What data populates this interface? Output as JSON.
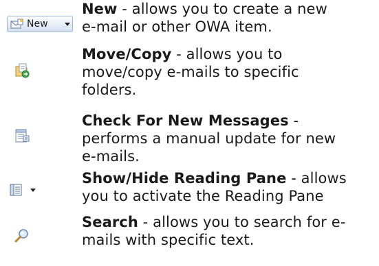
{
  "items": [
    {
      "icon": "new-item-icon",
      "button_label": "New",
      "term": "New",
      "lines": [
        " - allows you to create a new",
        "e-mail or other OWA item."
      ]
    },
    {
      "icon": "move-copy-icon",
      "term": "Move/Copy",
      "lines": [
        " - allows you to",
        "move/copy e-mails to specific",
        "folders."
      ]
    },
    {
      "icon": "check-messages-icon",
      "term": "Check For New Messages",
      "lines": [
        " -",
        "performs a manual update for new",
        "e-mails."
      ]
    },
    {
      "icon": "reading-pane-icon",
      "term": "Show/Hide Reading Pane",
      "lines": [
        " - allows",
        "you to activate the Reading Pane"
      ]
    },
    {
      "icon": "search-icon",
      "term": "Search",
      "lines": [
        " - allows you to search for e-",
        "mails with specific text."
      ]
    }
  ]
}
